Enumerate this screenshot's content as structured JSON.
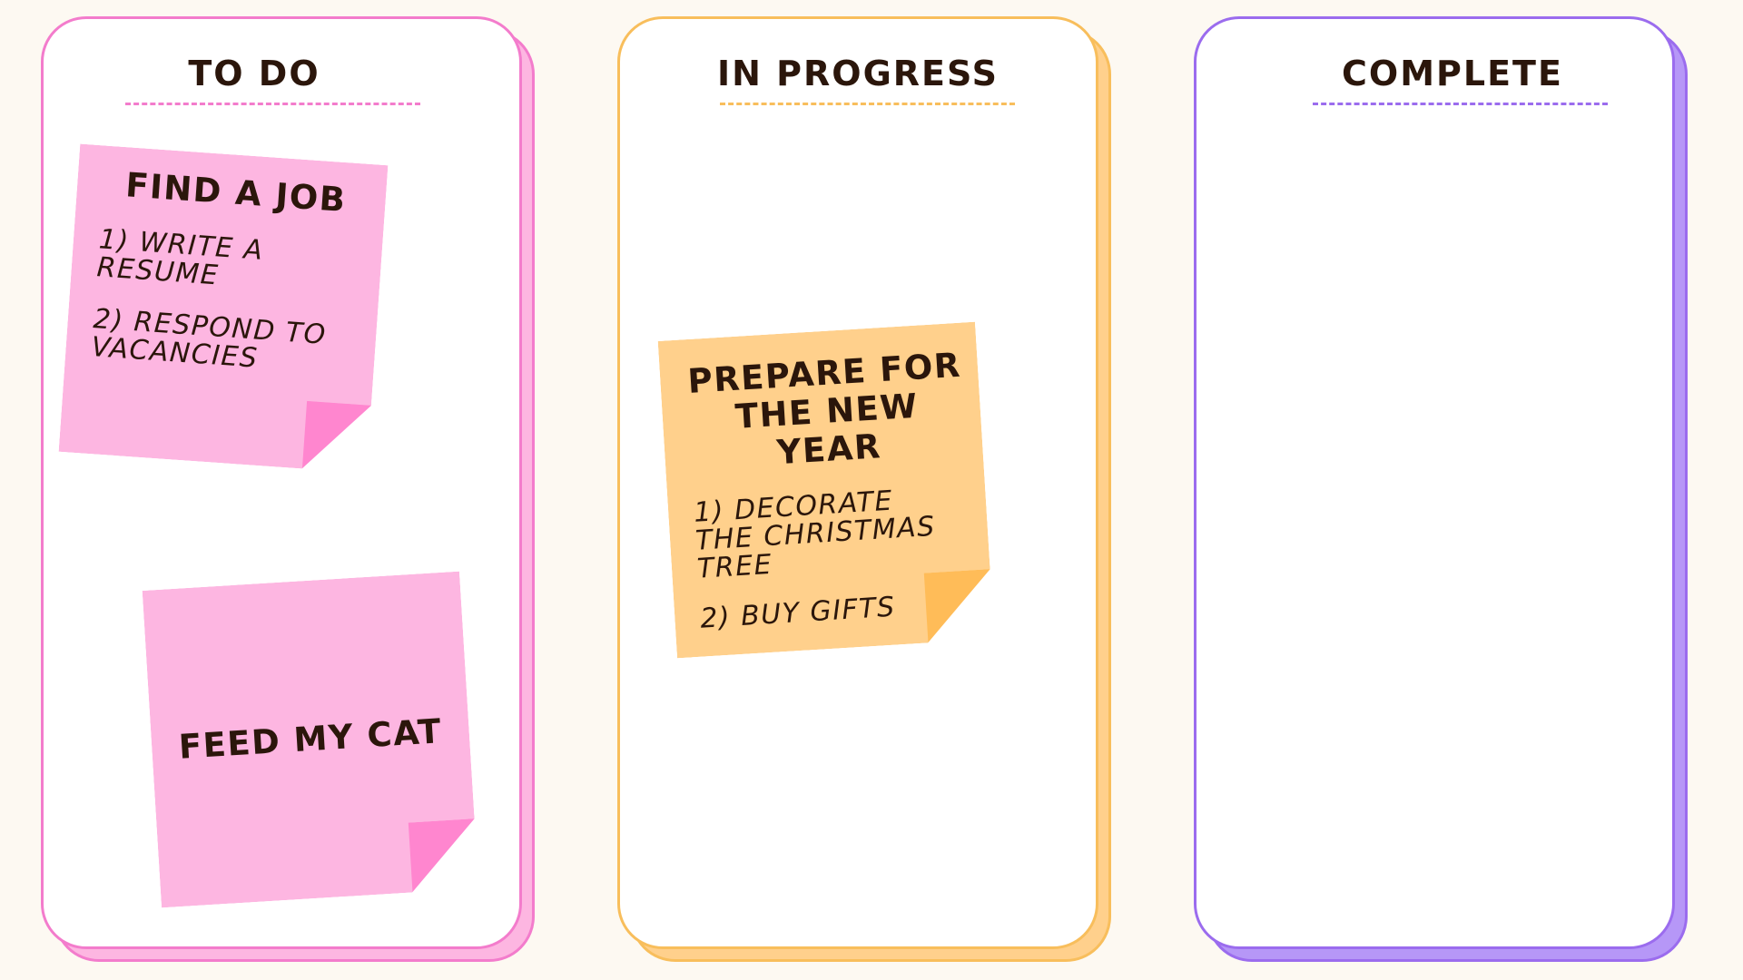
{
  "columns": [
    {
      "id": "todo",
      "title": "TO DO",
      "accent": "#f37ccc",
      "shadow": "#fdb6e1"
    },
    {
      "id": "in-progress",
      "title": "IN PROGRESS",
      "accent": "#f8be5c",
      "shadow": "#ffd08c"
    },
    {
      "id": "complete",
      "title": "COMPLETE",
      "accent": "#9b6cee",
      "shadow": "#b697f7"
    }
  ],
  "notes": {
    "find_job": {
      "title": "FIND A JOB",
      "items": [
        "1) WRITE A\nRESUME",
        "2) RESPOND TO\nVACANCIES"
      ],
      "color": "#fdb6e1"
    },
    "feed_cat": {
      "title": "FEED MY CAT",
      "color": "#fdb6e1"
    },
    "new_year": {
      "title": "PREPARE FOR\nTHE NEW YEAR",
      "items": [
        "1) DECORATE\nTHE CHRISTMAS\nTREE",
        "2) BUY GIFTS"
      ],
      "color": "#ffd08c"
    }
  },
  "colors": {
    "background": "#fdf9f2",
    "text": "#2b160b"
  }
}
